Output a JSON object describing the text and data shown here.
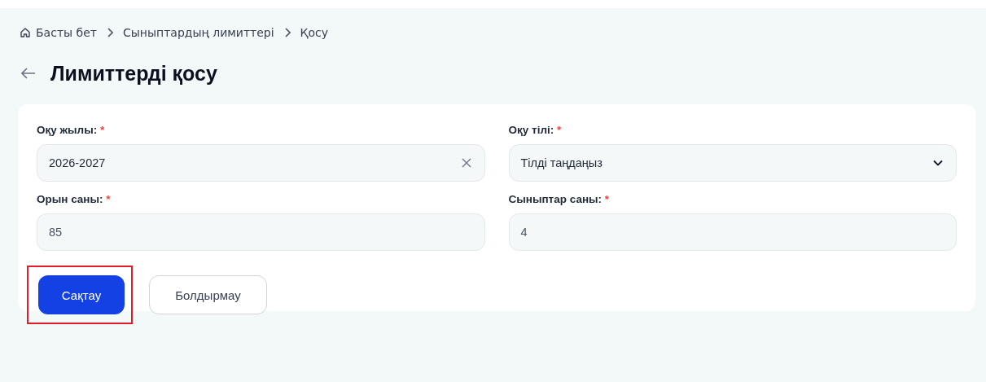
{
  "breadcrumbs": [
    {
      "label": "Басты бет",
      "kind": "home"
    },
    {
      "label": "Сыныптардың лимиттері",
      "kind": "link"
    },
    {
      "label": "Қосу",
      "kind": "current"
    }
  ],
  "title": "Лимиттерді қосу",
  "fields": [
    {
      "label": "Оқу жылы:",
      "required_mark": "*",
      "kind": "clearable",
      "value": "2026-2027"
    },
    {
      "label": "Оқу тілі:",
      "required_mark": "*",
      "kind": "select",
      "placeholder": "Тілді таңдаңыз"
    },
    {
      "label": "Орын саны:",
      "required_mark": "*",
      "kind": "text",
      "value": "85"
    },
    {
      "label": "Сыныптар саны:",
      "required_mark": "*",
      "kind": "text",
      "value": "4"
    }
  ],
  "buttons": [
    {
      "label": "Сақтау",
      "kind": "primary",
      "highlighted": true
    },
    {
      "label": "Болдырмау",
      "kind": "secondary",
      "highlighted": false
    }
  ]
}
